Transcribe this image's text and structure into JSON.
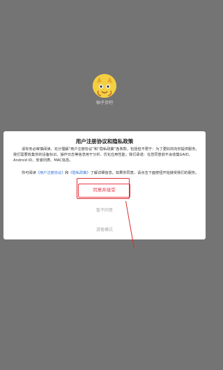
{
  "app": {
    "name": "柚子页吧"
  },
  "dialog": {
    "title": "用户注册协议和隐私政策",
    "paragraph1": "请你务必审慎阅读、充分理解“用户注册协议”和“隐私政策”各条款，包括但不限于：为了更好的向你提供服务，我们需要收集你的设备标识、操作日志等信息用于分析、优化应用性能，我们承诺：在您同意前不会收集GAID、Android ID、安装列表、MAC信息。",
    "paragraph2_prefix": "你可阅读",
    "agreement_link": "《用户注册协议》",
    "paragraph2_and": "和",
    "privacy_link": "《隐私政策》",
    "paragraph2_suffix": "了解详细信息。如果你同意，请点击下面按钮开始接受我们的服务。",
    "agree_label": "同意并接受",
    "disagree_label": "暂不同意",
    "guest_label": "游客模式"
  },
  "colors": {
    "accent": "#e8394b",
    "link": "#2f6fd6",
    "overlay": "#747474"
  }
}
